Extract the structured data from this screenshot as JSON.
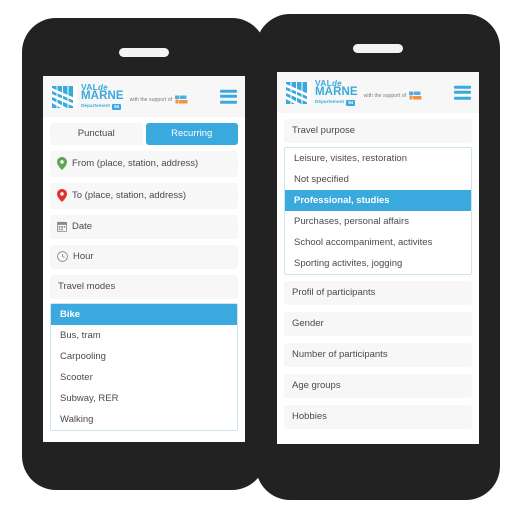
{
  "brand": {
    "line1_main": "VAL",
    "line1_de": "de",
    "line2": "MARNE",
    "dept": "Département",
    "chip": "94",
    "support_text": "with the support of",
    "mark_icon": "val-de-marne-chevron-logo",
    "support_icon": "partner-logo"
  },
  "menu": {
    "icon": "hamburger-menu-icon"
  },
  "phone1": {
    "tabs": [
      {
        "label": "Punctual",
        "active": false
      },
      {
        "label": "Recurring",
        "active": true
      }
    ],
    "fields": [
      {
        "label": "From (place, station, address)",
        "icon": "map-pin-green-icon",
        "color": "#5aa84f"
      },
      {
        "label": "To (place, station, address)",
        "icon": "map-pin-red-icon",
        "color": "#e0332a"
      },
      {
        "label": "Date",
        "icon": "calendar-icon",
        "color": "#8a8a8a"
      },
      {
        "label": "Hour",
        "icon": "clock-icon",
        "color": "#8a8a8a"
      }
    ],
    "section_title": "Travel modes",
    "travel_modes": [
      {
        "label": "Bike",
        "selected": true
      },
      {
        "label": "Bus, tram",
        "selected": false
      },
      {
        "label": "Carpooling",
        "selected": false
      },
      {
        "label": "Scooter",
        "selected": false
      },
      {
        "label": "Subway, RER",
        "selected": false
      },
      {
        "label": "Walking",
        "selected": false
      }
    ]
  },
  "phone2": {
    "section_title": "Travel purpose",
    "purposes": [
      {
        "label": "Leisure, visites, restoration",
        "selected": false
      },
      {
        "label": "Not specified",
        "selected": false
      },
      {
        "label": "Professional, studies",
        "selected": true
      },
      {
        "label": "Purchases, personal affairs",
        "selected": false
      },
      {
        "label": "School accompaniment, activites",
        "selected": false
      },
      {
        "label": "Sporting activites, jogging",
        "selected": false
      }
    ],
    "sections": [
      {
        "label": "Profil of participants"
      },
      {
        "label": "Gender"
      },
      {
        "label": "Number of participants"
      },
      {
        "label": "Age groups"
      },
      {
        "label": "Hobbies"
      }
    ]
  },
  "colors": {
    "accent": "#3aa9de",
    "chassis": "#222222",
    "field_bg": "#f7f7f7",
    "pin_from": "#5aa84f",
    "pin_to": "#e0332a"
  }
}
